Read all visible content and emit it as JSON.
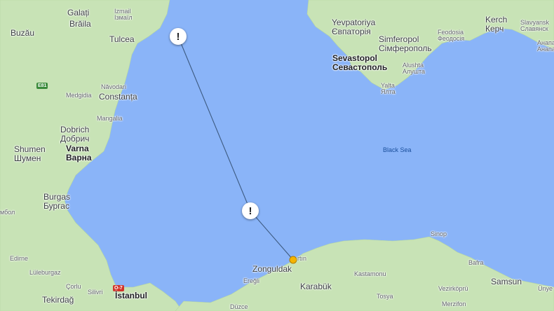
{
  "map": {
    "colors": {
      "sea": "#8ab4f8",
      "land": "#c8e3b6",
      "land_light": "#d9ecc9",
      "route": "#3d5a80",
      "border": "#7a7f86"
    },
    "sea_label": "Black Sea",
    "markers": [
      {
        "name": "alert-marker-north",
        "glyph": "!"
      },
      {
        "name": "alert-marker-south",
        "glyph": "!"
      }
    ],
    "road_shields": [
      {
        "text": "E81",
        "color": "green"
      },
      {
        "text": "O-7",
        "color": "red"
      }
    ],
    "places": [
      {
        "id": "galati",
        "text": "Galați",
        "cyr": "",
        "cls": "city"
      },
      {
        "id": "izmail",
        "text": "Izmail",
        "cyr": "Ізмаїл",
        "cls": "small"
      },
      {
        "id": "braila",
        "text": "Brăila",
        "cyr": "",
        "cls": "city"
      },
      {
        "id": "buzau",
        "text": "Buzău",
        "cyr": "",
        "cls": "city"
      },
      {
        "id": "tulcea",
        "text": "Tulcea",
        "cyr": "",
        "cls": "city"
      },
      {
        "id": "navodari",
        "text": "Năvodari",
        "cyr": "",
        "cls": "small"
      },
      {
        "id": "medgidia",
        "text": "Medgidia",
        "cyr": "",
        "cls": "small"
      },
      {
        "id": "constanta",
        "text": "Constanța",
        "cyr": "",
        "cls": "city"
      },
      {
        "id": "mangalia",
        "text": "Mangalia",
        "cyr": "",
        "cls": "small"
      },
      {
        "id": "dobrich",
        "text": "Dobrich",
        "cyr": "Добрич",
        "cls": "city"
      },
      {
        "id": "shumen",
        "text": "Shumen",
        "cyr": "Шумен",
        "cls": "city"
      },
      {
        "id": "varna",
        "text": "Varna",
        "cyr": "Варна",
        "cls": "big"
      },
      {
        "id": "burgas",
        "text": "Burgas",
        "cyr": "Бургас",
        "cls": "city"
      },
      {
        "id": "yambol",
        "text": "",
        "cyr": "мбол",
        "cls": "small"
      },
      {
        "id": "edirne",
        "text": "Edirne",
        "cyr": "",
        "cls": "small"
      },
      {
        "id": "luleburgaz",
        "text": "Lüleburgaz",
        "cyr": "",
        "cls": "small"
      },
      {
        "id": "corlu",
        "text": "Çorlu",
        "cyr": "",
        "cls": "small"
      },
      {
        "id": "silivri",
        "text": "Silivri",
        "cyr": "",
        "cls": "small"
      },
      {
        "id": "tekirdag",
        "text": "Tekirdağ",
        "cyr": "",
        "cls": "city"
      },
      {
        "id": "istanbul",
        "text": "İstanbul",
        "cyr": "",
        "cls": "big"
      },
      {
        "id": "duzce",
        "text": "Düzce",
        "cyr": "",
        "cls": "small"
      },
      {
        "id": "eregli",
        "text": "Ereğli",
        "cyr": "",
        "cls": "small"
      },
      {
        "id": "zonguldak",
        "text": "Zonguldak",
        "cyr": "",
        "cls": "city"
      },
      {
        "id": "bartin",
        "text": "rtın",
        "cyr": "",
        "cls": "small"
      },
      {
        "id": "karabuk",
        "text": "Karabük",
        "cyr": "",
        "cls": "city"
      },
      {
        "id": "kastamonu",
        "text": "Kastamonu",
        "cyr": "",
        "cls": "small"
      },
      {
        "id": "tosya",
        "text": "Tosya",
        "cyr": "",
        "cls": "small"
      },
      {
        "id": "sinop",
        "text": "Sinop",
        "cyr": "",
        "cls": "small"
      },
      {
        "id": "bafra",
        "text": "Bafra",
        "cyr": "",
        "cls": "small"
      },
      {
        "id": "samsun",
        "text": "Samsun",
        "cyr": "",
        "cls": "city"
      },
      {
        "id": "vezirkopru",
        "text": "Vezirköprü",
        "cyr": "",
        "cls": "small"
      },
      {
        "id": "merzifon",
        "text": "Merzifon",
        "cyr": "",
        "cls": "small"
      },
      {
        "id": "unye",
        "text": "Ünye",
        "cyr": "",
        "cls": "small"
      },
      {
        "id": "yevpatoriya",
        "text": "Yevpatoriya",
        "cyr": "Євпаторія",
        "cls": "city"
      },
      {
        "id": "simferopol",
        "text": "Simferopol",
        "cyr": "Сімферополь",
        "cls": "city"
      },
      {
        "id": "sevastopol",
        "text": "Sevastopol",
        "cyr": "Севастополь",
        "cls": "big"
      },
      {
        "id": "alushta",
        "text": "Alushta",
        "cyr": "Алушта",
        "cls": "small"
      },
      {
        "id": "yalta",
        "text": "Yalta",
        "cyr": "Ялта",
        "cls": "small"
      },
      {
        "id": "feodosia",
        "text": "Feodosia",
        "cyr": "Феодосія",
        "cls": "small"
      },
      {
        "id": "kerch",
        "text": "Kerch",
        "cyr": "Керч",
        "cls": "city"
      },
      {
        "id": "slavyansk",
        "text": "Slavyansk",
        "cyr": "Славянск",
        "cls": "small"
      },
      {
        "id": "anapa",
        "text": "Анапа",
        "cyr": "Анапа",
        "cls": "small"
      }
    ]
  }
}
